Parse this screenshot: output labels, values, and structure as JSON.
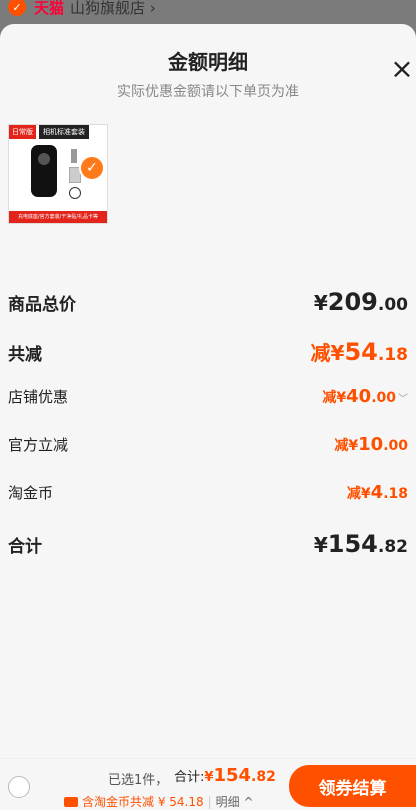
{
  "header": {
    "tmall_label": "天猫",
    "shop_name": "山狗旗舰店 ›"
  },
  "sheet": {
    "title": "金额明细",
    "subtitle": "实际优惠金额请以下单页为准",
    "close_label": "×"
  },
  "product": {
    "tag_daily": "日常版",
    "tag_title": "相机标准套装",
    "bottom_tags": "充电底座/官方套装/干净贴/礼品卡等",
    "selected_mark": "✓"
  },
  "rows": {
    "subtotal": {
      "label": "商品总价",
      "yuan": "¥",
      "int": "209",
      "dec": ".00"
    },
    "total_discount": {
      "label": "共减",
      "prefix": "减¥",
      "int": "54",
      "dec": ".18"
    },
    "shop_discount": {
      "label": "店铺优惠",
      "prefix": "减¥",
      "int": "40",
      "dec": ".00",
      "chevron": "﹀"
    },
    "official_discount": {
      "label": "官方立减",
      "prefix": "减¥",
      "int": "10",
      "dec": ".00"
    },
    "taojinbi": {
      "label": "淘金币",
      "prefix": "减¥",
      "int": "4",
      "dec": ".18"
    },
    "grand_total": {
      "label": "合计",
      "yuan": "¥",
      "int": "154",
      "dec": ".82"
    }
  },
  "footer": {
    "selected_count": "已选1件，",
    "total_label": "合计:",
    "total_yuan": "¥",
    "total_int": "154",
    "total_dec": ".82",
    "discount_text": "含淘金币共减 ¥ 54.18",
    "detail_text": "明细 ^",
    "checkout_label": "领券结算"
  },
  "colors": {
    "accent": "#ff5000",
    "tmall_red": "#ff0036"
  }
}
